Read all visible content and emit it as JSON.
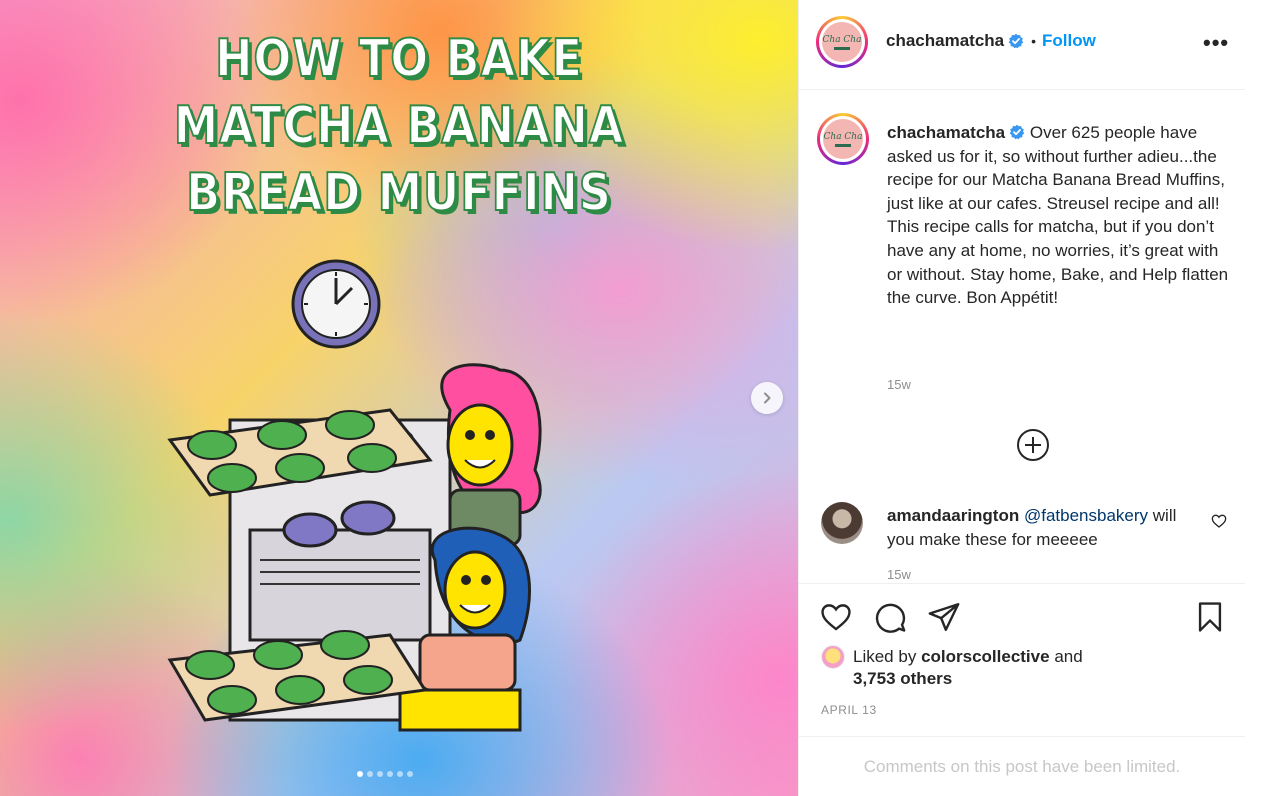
{
  "media": {
    "title_lines": [
      "HOW TO BAKE",
      "MATCHA BANANA",
      "BREAD MUFFINS"
    ],
    "carousel": {
      "total": 6,
      "active": 1
    },
    "colors": {
      "title_fill": "#ffffff",
      "title_outline": "#2e8b45"
    }
  },
  "header": {
    "username": "chachamatcha",
    "separator": "•",
    "follow_label": "Follow",
    "more_label": "•••",
    "avatar_text": "Cha Cha"
  },
  "caption": {
    "username": "chachamatcha",
    "text": "Over 625 people have asked us for it, so without further adieu...the recipe for our Matcha Banana Bread Muffins, just like at our cafes. Streusel recipe and all! This recipe calls for matcha, but if you don’t have any at home, no worries, it’s great with or without. Stay home, Bake, and Help flatten the curve. Bon Appétit!",
    "time": "15w"
  },
  "comment": {
    "username": "amandaarington",
    "mention": "@fatbensbakery",
    "text": "will you make these for meeeee",
    "time": "15w"
  },
  "likes": {
    "prefix": "Liked by",
    "user": "colorscollective",
    "and": "and",
    "others": "3,753 others"
  },
  "post_date": "APRIL 13",
  "comments_limited": "Comments on this post have been limited.",
  "colors": {
    "accent": "#0095f6",
    "verified": "#3897f0",
    "muted": "#8e8e8e"
  }
}
